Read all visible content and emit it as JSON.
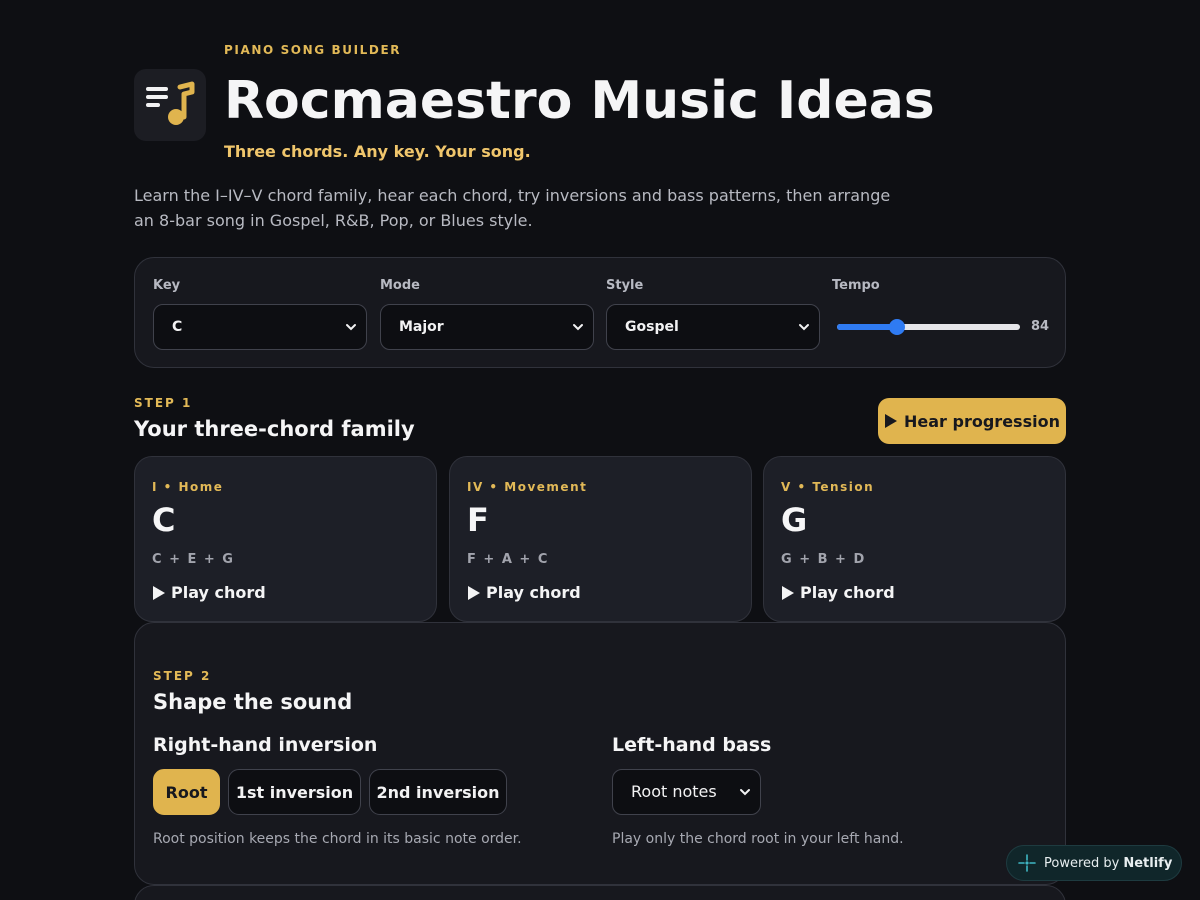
{
  "header": {
    "eyebrow": "PIANO SONG BUILDER",
    "title": "Rocmaestro Music Ideas",
    "tagline": "Three chords. Any key. Your song.",
    "intro": "Learn the I–IV–V chord family, hear each chord, try inversions and bass patterns, then arrange an 8-bar song in Gospel, R&B, Pop, or Blues style.",
    "logo_icon": "music-note-list-icon"
  },
  "controls": {
    "key": {
      "label": "Key",
      "value": "C"
    },
    "mode": {
      "label": "Mode",
      "value": "Major"
    },
    "style": {
      "label": "Style",
      "value": "Gospel"
    },
    "tempo": {
      "label": "Tempo",
      "value": "84",
      "fraction": 0.33
    }
  },
  "step1": {
    "label": "STEP 1",
    "title": "Your three-chord family",
    "hear_button": "Hear progression",
    "chords": [
      {
        "role": "I • Home",
        "name": "C",
        "notes": "C + E + G",
        "play": "Play chord"
      },
      {
        "role": "IV • Movement",
        "name": "F",
        "notes": "F + A + C",
        "play": "Play chord"
      },
      {
        "role": "V • Tension",
        "name": "G",
        "notes": "G + B + D",
        "play": "Play chord"
      }
    ]
  },
  "step2": {
    "label": "STEP 2",
    "title": "Shape the sound",
    "inversion": {
      "title": "Right-hand inversion",
      "options": [
        "Root",
        "1st inversion",
        "2nd inversion"
      ],
      "selected": "Root",
      "hint": "Root position keeps the chord in its basic note order."
    },
    "bass": {
      "title": "Left-hand bass",
      "value": "Root notes",
      "hint": "Play only the chord root in your left hand."
    }
  },
  "badge": {
    "prefix": "Powered by",
    "brand": "Netlify"
  },
  "colors": {
    "background": "#0e0f13",
    "accent": "#e0b44e",
    "slider": "#2f7bf3"
  }
}
